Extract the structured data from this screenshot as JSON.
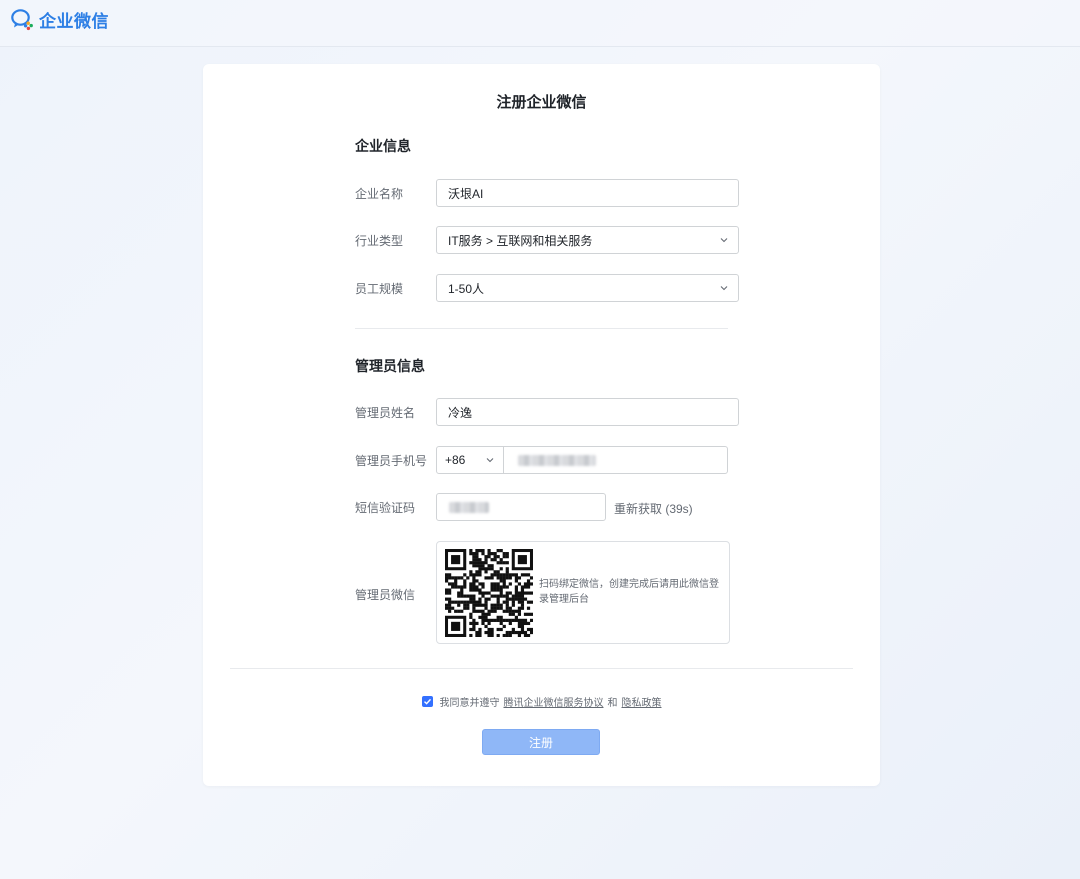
{
  "header": {
    "logo_text": "企业微信"
  },
  "form": {
    "title": "注册企业微信",
    "company_section": {
      "title": "企业信息",
      "name_label": "企业名称",
      "name_value": "沃垠AI",
      "industry_label": "行业类型",
      "industry_value": "IT服务 > 互联网和相关服务",
      "size_label": "员工规模",
      "size_value": "1-50人"
    },
    "admin_section": {
      "title": "管理员信息",
      "name_label": "管理员姓名",
      "name_value": "冷逸",
      "phone_label": "管理员手机号",
      "phone_code": "+86",
      "sms_label": "短信验证码",
      "resend_text": "重新获取 (39s)",
      "wechat_label": "管理员微信",
      "qr_tip": "扫码绑定微信，创建完成后请用此微信登录管理后台"
    },
    "agreement": {
      "checked": true,
      "prefix": "我同意并遵守",
      "terms_link": "腾讯企业微信服务协议",
      "and": "和",
      "privacy_link": "隐私政策"
    },
    "submit_label": "注册"
  },
  "colors": {
    "brand": "#2d7fe5",
    "primary_disabled": "#8fb7f7",
    "checkbox": "#3370ff"
  },
  "icons": {
    "logo": "wecom-logo-icon",
    "chevron": "chevron-down-icon",
    "check": "check-icon",
    "qr": "qr-code-icon"
  }
}
